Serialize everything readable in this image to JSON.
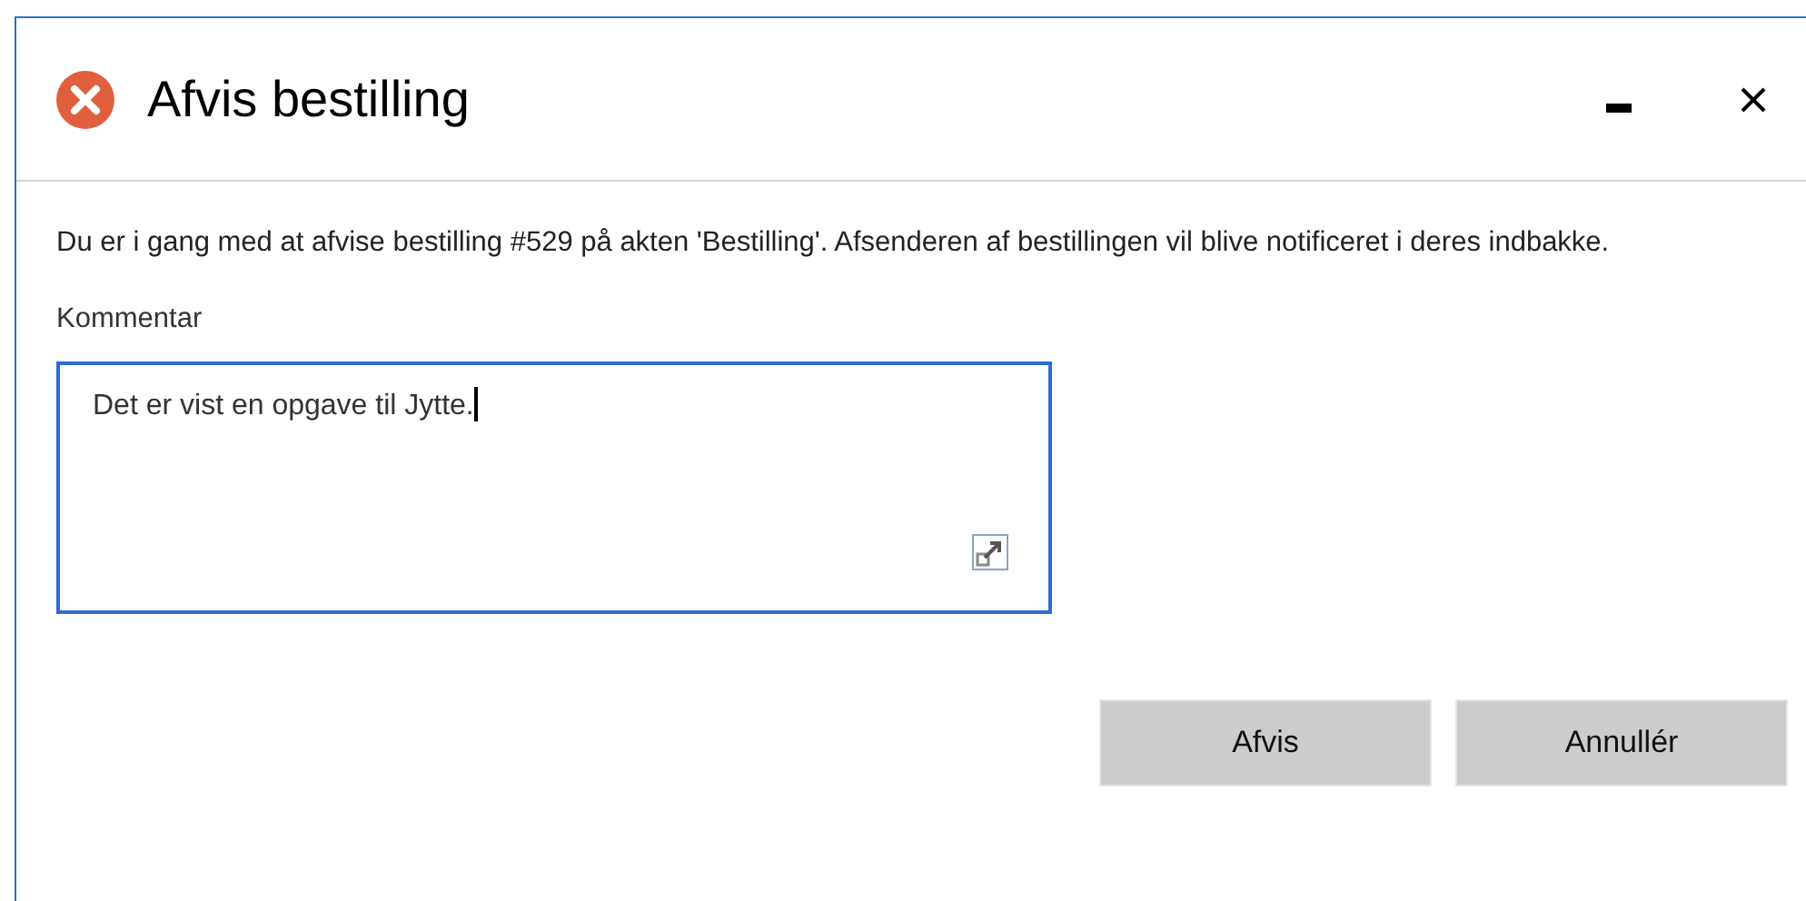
{
  "window": {
    "title": "Afvis bestilling"
  },
  "message": "Du er i gang med at afvise bestilling #529 på akten 'Bestilling'. Afsenderen af bestillingen vil blive notificeret i deres indbakke.",
  "comment": {
    "label": "Kommentar",
    "value": "Det er vist en opgave til Jytte."
  },
  "buttons": [
    "Afvis",
    "Annullér"
  ]
}
